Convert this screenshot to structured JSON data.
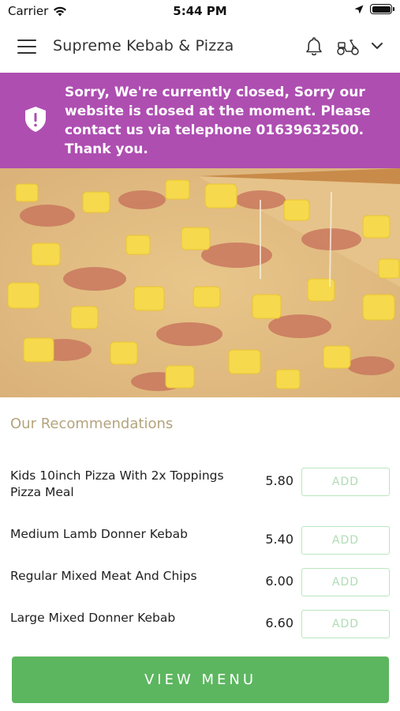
{
  "status_bar": {
    "carrier": "Carrier",
    "time": "5:44 PM"
  },
  "header": {
    "title": "Supreme Kebab & Pizza",
    "icons": [
      "menu-icon",
      "bell-icon",
      "scooter-icon",
      "chevron-down-icon"
    ]
  },
  "banner": {
    "color": "#ae4eb1",
    "icon": "shield-alert-icon",
    "message": "Sorry, We're currently closed, Sorry our website is closed at the moment. Please contact us via telephone 01639632500. Thank you."
  },
  "hero": {
    "icon": "pizza-photo"
  },
  "recommendations": {
    "title": "Our Recommendations",
    "items": [
      {
        "name": "Kids 10inch Pizza With 2x Toppings Pizza Meal",
        "price": "5.80",
        "button": "ADD"
      },
      {
        "name": "Medium Lamb  Donner Kebab",
        "price": "5.40",
        "button": "ADD"
      },
      {
        "name": "Regular Mixed Meat And Chips",
        "price": "6.00",
        "button": "ADD"
      },
      {
        "name": "Large Mixed Donner Kebab",
        "price": "6.60",
        "button": "ADD"
      }
    ]
  },
  "view_menu": {
    "label": "VIEW MENU",
    "color": "#5cb65f"
  }
}
